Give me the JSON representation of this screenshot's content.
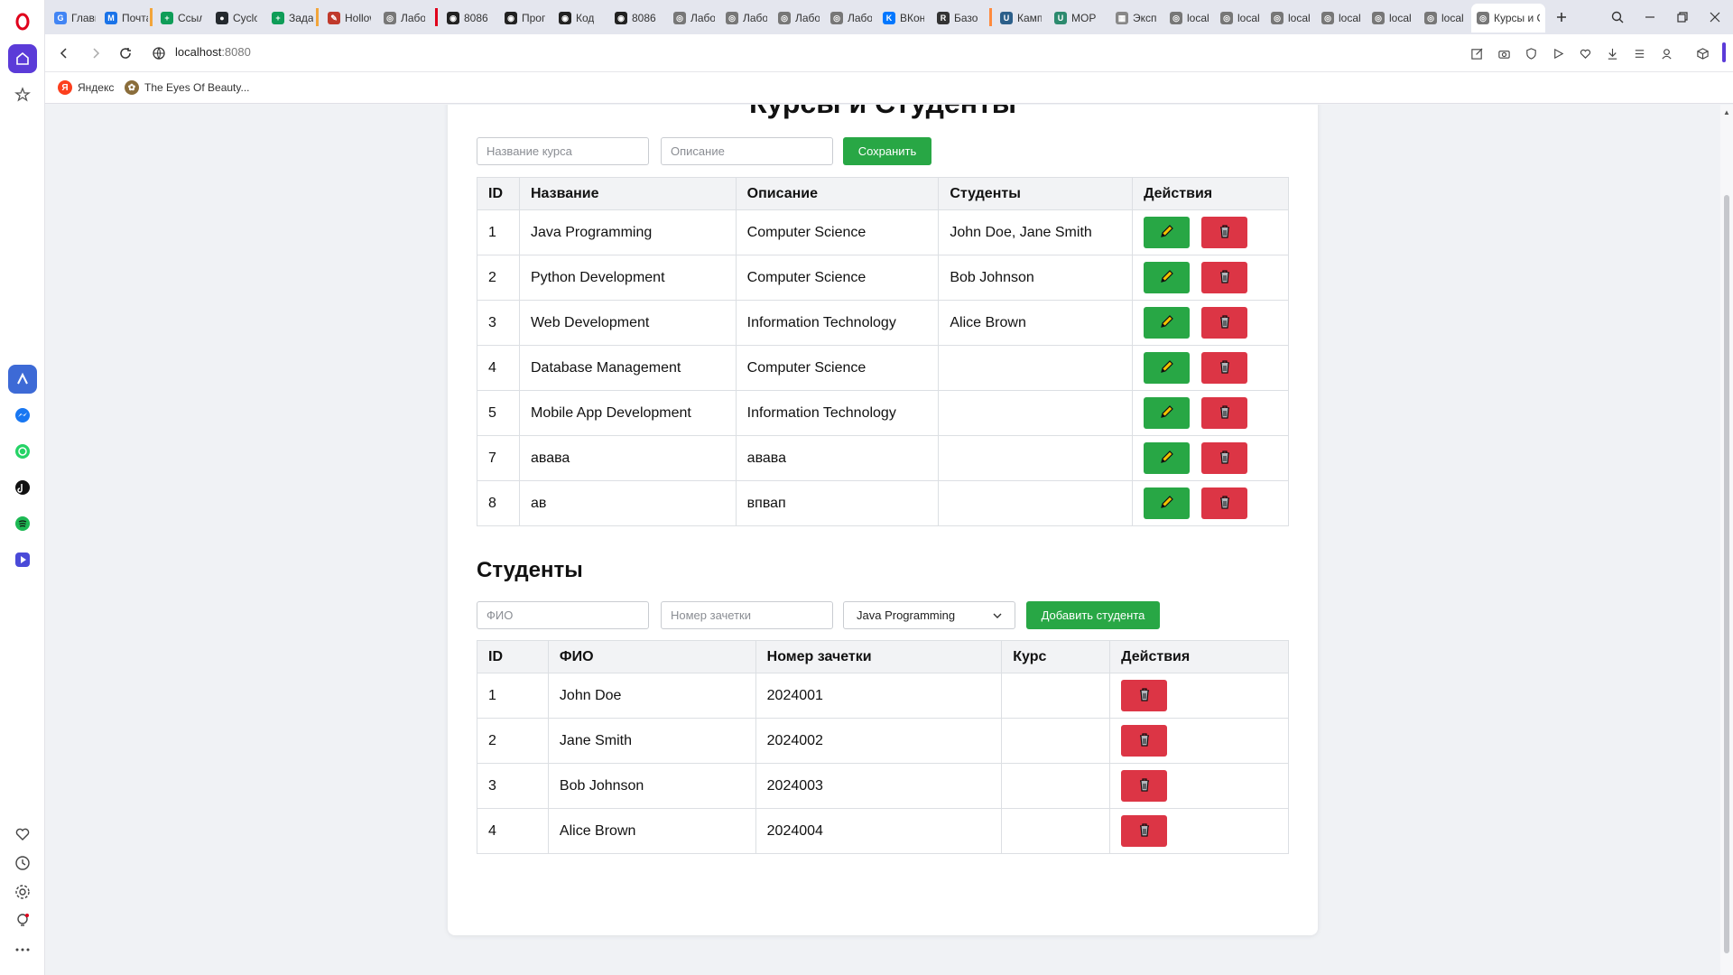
{
  "browser": {
    "tabs": [
      {
        "label": "Главная",
        "fav_color": "#4285f4",
        "fav_glyph": "G"
      },
      {
        "label": "Почта",
        "fav_color": "#1a73e8",
        "fav_glyph": "M"
      },
      {
        "label": "Ссылки",
        "fav_color": "#0f9d58",
        "fav_glyph": "+"
      },
      {
        "label": "Cyclone",
        "fav_color": "#24292e",
        "fav_glyph": "●"
      },
      {
        "label": "Задания",
        "fav_color": "#0f9d58",
        "fav_glyph": "+"
      },
      {
        "label": "Hollow",
        "fav_color": "#c0392b",
        "fav_glyph": "✎"
      },
      {
        "label": "Лабо",
        "fav_color": "#777777",
        "fav_glyph": "◎"
      },
      {
        "label": "8086",
        "fav_color": "#222222",
        "fav_glyph": "◉"
      },
      {
        "label": "Прог",
        "fav_color": "#222222",
        "fav_glyph": "◉"
      },
      {
        "label": "Код",
        "fav_color": "#222222",
        "fav_glyph": "◉"
      },
      {
        "label": "8086",
        "fav_color": "#222222",
        "fav_glyph": "◉"
      },
      {
        "label": "Лабо",
        "fav_color": "#777777",
        "fav_glyph": "◎"
      },
      {
        "label": "Лабо",
        "fav_color": "#777777",
        "fav_glyph": "◎"
      },
      {
        "label": "Лабо",
        "fav_color": "#777777",
        "fav_glyph": "◎"
      },
      {
        "label": "Лабо",
        "fav_color": "#777777",
        "fav_glyph": "◎"
      },
      {
        "label": "ВКон",
        "fav_color": "#0077ff",
        "fav_glyph": "K"
      },
      {
        "label": "Базо",
        "fav_color": "#333333",
        "fav_glyph": "R"
      },
      {
        "label": "Камп",
        "fav_color": "#2c5f8a",
        "fav_glyph": "U"
      },
      {
        "label": "МОР",
        "fav_color": "#2c8a6e",
        "fav_glyph": "U"
      },
      {
        "label": "Эксп",
        "fav_color": "#888888",
        "fav_glyph": "▦"
      },
      {
        "label": "local",
        "fav_color": "#777777",
        "fav_glyph": "◎"
      },
      {
        "label": "local",
        "fav_color": "#777777",
        "fav_glyph": "◎"
      },
      {
        "label": "local",
        "fav_color": "#777777",
        "fav_glyph": "◎"
      },
      {
        "label": "local",
        "fav_color": "#777777",
        "fav_glyph": "◎"
      },
      {
        "label": "local",
        "fav_color": "#777777",
        "fav_glyph": "◎"
      },
      {
        "label": "local",
        "fav_color": "#777777",
        "fav_glyph": "◎"
      },
      {
        "label": "Курсы и С",
        "fav_color": "#777777",
        "fav_glyph": "◎"
      }
    ],
    "url_host": "localhost",
    "url_port": ":8080",
    "bookmarks": [
      {
        "label": "Яндекс",
        "icon_color": "#fc3f1d",
        "glyph": "Я"
      },
      {
        "label": "The Eyes Of Beauty...",
        "icon_color": "#8a6d3b",
        "glyph": "✿"
      }
    ]
  },
  "page": {
    "title": "Курсы и Студенты",
    "course_form": {
      "name_placeholder": "Название курса",
      "description_placeholder": "Описание",
      "save_label": "Сохранить"
    },
    "courses_table": {
      "headers": [
        "ID",
        "Название",
        "Описание",
        "Студенты",
        "Действия"
      ],
      "rows": [
        {
          "id": "1",
          "name": "Java Programming",
          "description": "Computer Science",
          "students": "John Doe, Jane Smith"
        },
        {
          "id": "2",
          "name": "Python Development",
          "description": "Computer Science",
          "students": "Bob Johnson"
        },
        {
          "id": "3",
          "name": "Web Development",
          "description": "Information Technology",
          "students": "Alice Brown"
        },
        {
          "id": "4",
          "name": "Database Management",
          "description": "Computer Science",
          "students": ""
        },
        {
          "id": "5",
          "name": "Mobile App Development",
          "description": "Information Technology",
          "students": ""
        },
        {
          "id": "7",
          "name": "авава",
          "description": "авава",
          "students": ""
        },
        {
          "id": "8",
          "name": "ав",
          "description": "впвап",
          "students": ""
        }
      ]
    },
    "students_heading": "Студенты",
    "student_form": {
      "fio_placeholder": "ФИО",
      "record_placeholder": "Номер зачетки",
      "course_selected": "Java Programming",
      "add_label": "Добавить студента"
    },
    "students_table": {
      "headers": [
        "ID",
        "ФИО",
        "Номер зачетки",
        "Курс",
        "Действия"
      ],
      "rows": [
        {
          "id": "1",
          "fio": "John Doe",
          "record": "2024001",
          "course": ""
        },
        {
          "id": "2",
          "fio": "Jane Smith",
          "record": "2024002",
          "course": ""
        },
        {
          "id": "3",
          "fio": "Bob Johnson",
          "record": "2024003",
          "course": ""
        },
        {
          "id": "4",
          "fio": "Alice Brown",
          "record": "2024004",
          "course": ""
        }
      ]
    }
  },
  "colors": {
    "accent_green": "#28a745",
    "danger_red": "#dc3545",
    "opera_red": "#e0001b",
    "opera_purple": "#5b3bd8"
  }
}
